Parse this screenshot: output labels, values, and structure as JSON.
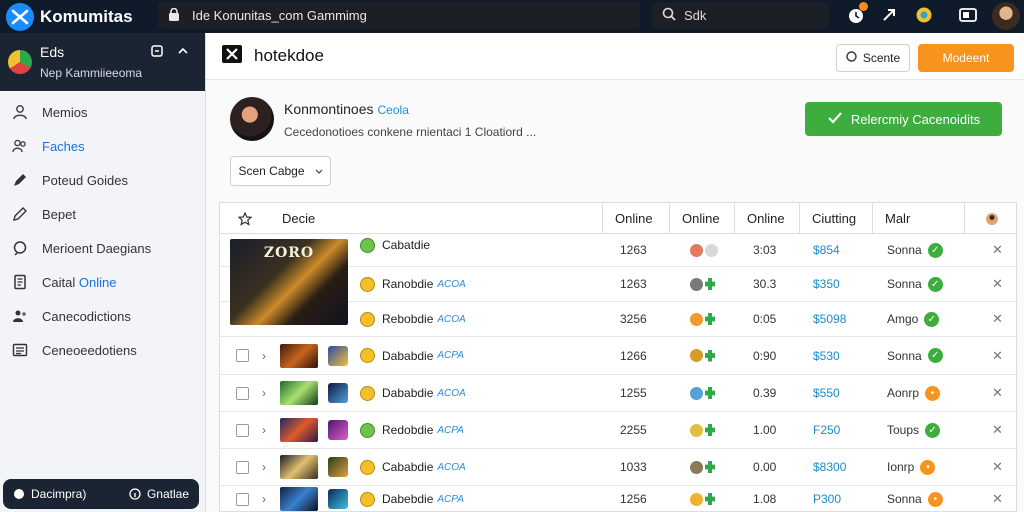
{
  "app": {
    "name": "Komumitas"
  },
  "topbar": {
    "url": "Ide Konunitas_com Gammimg",
    "search_placeholder": "Sdk"
  },
  "sidebar": {
    "header": {
      "title": "Eds",
      "subtitle": "Nep Kammiieeoma"
    },
    "items": [
      {
        "label": "Memios",
        "icon": "user-icon",
        "active": false
      },
      {
        "label": "Faches",
        "icon": "users-icon",
        "active": true
      },
      {
        "label": "Poteud Goides",
        "icon": "pen-icon",
        "active": false
      },
      {
        "label": "Bepet",
        "icon": "pencil-icon",
        "active": false
      },
      {
        "label": "Merioent Daegians",
        "icon": "chat-icon",
        "active": false
      },
      {
        "label": "Caital ",
        "label_highlight": "Online",
        "icon": "document-icon",
        "active": false
      },
      {
        "label": "Canecodictions",
        "icon": "people-icon",
        "active": false
      },
      {
        "label": "Ceneoeedotiens",
        "icon": "list-icon",
        "active": false
      }
    ],
    "footer": {
      "left": "Dacimpra)",
      "right": "Gnatlae"
    }
  },
  "header": {
    "title": "hotekdoe",
    "btn_outline": "Scente",
    "btn_primary": "Modeent"
  },
  "community": {
    "name": "Konmontinoes",
    "tag": "Ceola",
    "desc": "Cecedonotioes conkene rnientaci 1 Cloatiord ...",
    "join_label": "Relercmiy Cacenoidits"
  },
  "sort": {
    "label": "Scen Cabge"
  },
  "table": {
    "headers": [
      "Decie",
      "Online",
      "Online",
      "Online",
      "Ciutting",
      "Malr"
    ],
    "rows": [
      {
        "name": "Cabatdie",
        "tag": "",
        "players": "1263",
        "count": "3:03",
        "price": "$854",
        "status": "Sonna",
        "status_type": "ok",
        "coin": "green",
        "dots": [
          "#e07a5f",
          "#d8d8d8"
        ]
      },
      {
        "name": "Ranobdie",
        "tag": "ACOA",
        "players": "1263",
        "count": "30.3",
        "price": "$350",
        "status": "Sonna",
        "status_type": "ok",
        "coin": "gold",
        "dots": [
          "#7a7a7a",
          "puzzle"
        ]
      },
      {
        "name": "Rebobdie",
        "tag": "ACOA",
        "players": "3256",
        "count": "0:05",
        "price": "$5098",
        "status": "Amgo",
        "status_type": "ok",
        "coin": "gold",
        "dots": [
          "#f29a2e",
          "puzzle"
        ]
      },
      {
        "name": "Dababdie",
        "tag": "ACPA",
        "players": "1266",
        "count": "0:90",
        "price": "$530",
        "status": "Sonna",
        "status_type": "ok",
        "coin": "gold",
        "dots": [
          "#d89a2a",
          "puzzle"
        ]
      },
      {
        "name": "Dababdie",
        "tag": "ACOA",
        "players": "1255",
        "count": "0.39",
        "price": "$550",
        "status": "Aonrp",
        "status_type": "warn",
        "coin": "gold",
        "dots": [
          "#5aa0d8",
          "puzzle"
        ]
      },
      {
        "name": "Redobdie",
        "tag": "ACPA",
        "players": "2255",
        "count": "1.00",
        "price": "F250",
        "status": "Toups",
        "status_type": "ok",
        "coin": "green",
        "dots": [
          "#e0c040",
          "puzzle"
        ]
      },
      {
        "name": "Cababdie",
        "tag": "ACOA",
        "players": "1033",
        "count": "0.00",
        "price": "$8300",
        "status": "Ionrp",
        "status_type": "warn",
        "coin": "gold",
        "dots": [
          "#8a7a5a",
          "puzzle"
        ]
      },
      {
        "name": "Dabebdie",
        "tag": "ACPA",
        "players": "1256",
        "count": "1.08",
        "price": "P300",
        "status": "Sonna",
        "status_type": "warn",
        "coin": "gold",
        "dots": [
          "#f2b02e",
          "puzzle"
        ]
      }
    ],
    "featured_image_text": "ZORO"
  },
  "colors": {
    "topbar": "#0f1a2a",
    "accent": "#1a6fe0",
    "green": "#3dae3d",
    "orange": "#f7941d",
    "price": "#1a8cc8"
  }
}
